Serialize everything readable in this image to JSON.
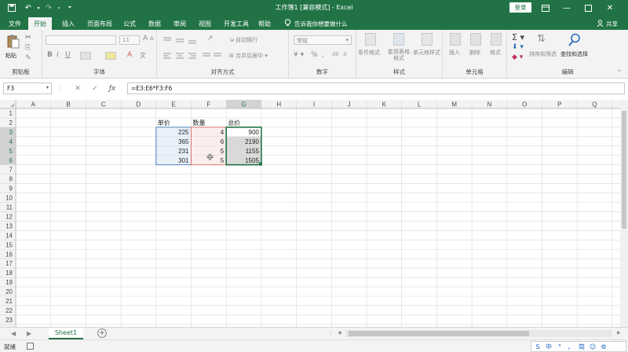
{
  "window": {
    "title": "工作簿1  [兼容模式]  -  Excel",
    "login_label": "登录",
    "controls": [
      "restore-icon",
      "minimize-icon",
      "maximize-icon",
      "close-icon"
    ]
  },
  "quick_access": [
    "save-icon",
    "undo-icon",
    "redo-icon",
    "customize-icon"
  ],
  "tabs": [
    {
      "label": "文件"
    },
    {
      "label": "开始",
      "active": true
    },
    {
      "label": "插入"
    },
    {
      "label": "页面布局"
    },
    {
      "label": "公式"
    },
    {
      "label": "数据"
    },
    {
      "label": "审阅"
    },
    {
      "label": "视图"
    },
    {
      "label": "开发工具"
    },
    {
      "label": "帮助"
    }
  ],
  "tellme": "告诉我你想要做什么",
  "share": "共享",
  "ribbon": {
    "groups": [
      {
        "label": "剪贴板",
        "items": [
          "粘贴"
        ]
      },
      {
        "label": "字体",
        "font_size": "11"
      },
      {
        "label": "对齐方式",
        "items": [
          "自动换行",
          "合并后居中"
        ]
      },
      {
        "label": "数字",
        "format": "常规"
      },
      {
        "label": "样式",
        "items": [
          "条件格式",
          "套用表格格式",
          "单元格样式"
        ]
      },
      {
        "label": "单元格",
        "items": [
          "插入",
          "删除",
          "格式"
        ]
      },
      {
        "label": "编辑",
        "items": [
          "排序和筛选",
          "查找和选择"
        ]
      }
    ]
  },
  "formula_bar": {
    "name_box": "F3",
    "formula": "=E3:E6*F3:F6"
  },
  "sheet": {
    "columns": [
      "A",
      "B",
      "C",
      "D",
      "E",
      "F",
      "G",
      "H",
      "I",
      "J",
      "K",
      "L",
      "M",
      "N",
      "O",
      "P",
      "Q"
    ],
    "rows": [
      "1",
      "2",
      "3",
      "4",
      "5",
      "6",
      "7",
      "8",
      "9",
      "10",
      "11",
      "12",
      "13",
      "14",
      "15",
      "16",
      "17",
      "18",
      "19",
      "20",
      "21",
      "22",
      "23"
    ],
    "headers": {
      "E2": "单价",
      "F2": "数量",
      "G2": "总价"
    },
    "values": {
      "E3": "225",
      "E4": "365",
      "E5": "231",
      "E6": "301",
      "F3": "4",
      "F4": "6",
      "F5": "5",
      "F6": "5",
      "G3": "900",
      "G4": "2190",
      "G5": "1155",
      "G6": "1505"
    },
    "selected_column": "G",
    "selected_rows": [
      "3",
      "4",
      "5",
      "6"
    ]
  },
  "sheet_tabs": [
    "Sheet1"
  ],
  "status": {
    "ready": "就绪"
  },
  "ime": [
    "中",
    "°",
    "，",
    "简",
    "☺",
    "⚙"
  ]
}
